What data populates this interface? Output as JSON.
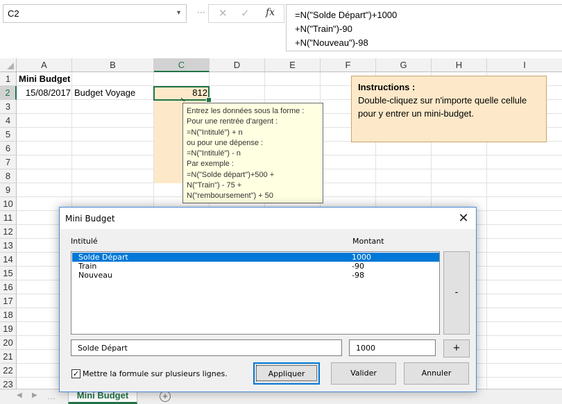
{
  "namebox": {
    "value": "C2"
  },
  "formula_bar": {
    "fx_label": "fx",
    "lines": [
      "=N(\"Solde Départ\")+1000",
      "+N(\"Train\")-90",
      "+N(\"Nouveau\")-98"
    ]
  },
  "grid": {
    "columns": [
      "A",
      "B",
      "C",
      "D",
      "E",
      "F",
      "G",
      "H",
      "I"
    ],
    "rows": [
      "1",
      "2",
      "3",
      "4",
      "5",
      "6",
      "7",
      "8",
      "9",
      "10",
      "11",
      "12",
      "13",
      "14",
      "15",
      "16",
      "17",
      "18",
      "19",
      "20",
      "21",
      "22",
      "23"
    ],
    "cells": {
      "A1": "Mini Budget",
      "A2": "15/08/2017",
      "B2": "Budget Voyage",
      "C2": "812"
    }
  },
  "comment": {
    "lines": [
      "Entrez les données sous la forme :",
      "Pour une rentrée d'argent :",
      "=N(\"Intitulé\") + n",
      "ou pour une dépense :",
      "=N(\"Intitulé\") - n",
      "Par exemple :",
      "=N(\"Solde départ\")+500 +",
      "N(\"Train\") - 75 +",
      "N(\"remboursement\") + 50"
    ]
  },
  "instructions": {
    "title": "Instructions :",
    "body": "Double-cliquez sur n'importe quelle cellule pour y entrer un mini-budget."
  },
  "dialog": {
    "title": "Mini Budget",
    "col_label": "Intitulé",
    "col_amount": "Montant",
    "items": [
      {
        "label": "Solde Départ",
        "amount": "1000"
      },
      {
        "label": "Train",
        "amount": "-90"
      },
      {
        "label": "Nouveau",
        "amount": "-98"
      }
    ],
    "remove_label": "-",
    "add_label": "+",
    "label_input": "Solde Départ",
    "amount_input": "1000",
    "checkbox_label": "Mettre la formule sur plusieurs lignes.",
    "checkbox_mark": "✓",
    "apply_label": "Appliquer",
    "validate_label": "Valider",
    "cancel_label": "Annuler",
    "close_glyph": "✕"
  },
  "sheets": {
    "active": "Mini Budget",
    "add_glyph": "+"
  },
  "colors": {
    "accent": "#217346",
    "cell_fill": "#fde9c9",
    "comment_fill": "#ffffe1",
    "selection": "#0078d7"
  }
}
